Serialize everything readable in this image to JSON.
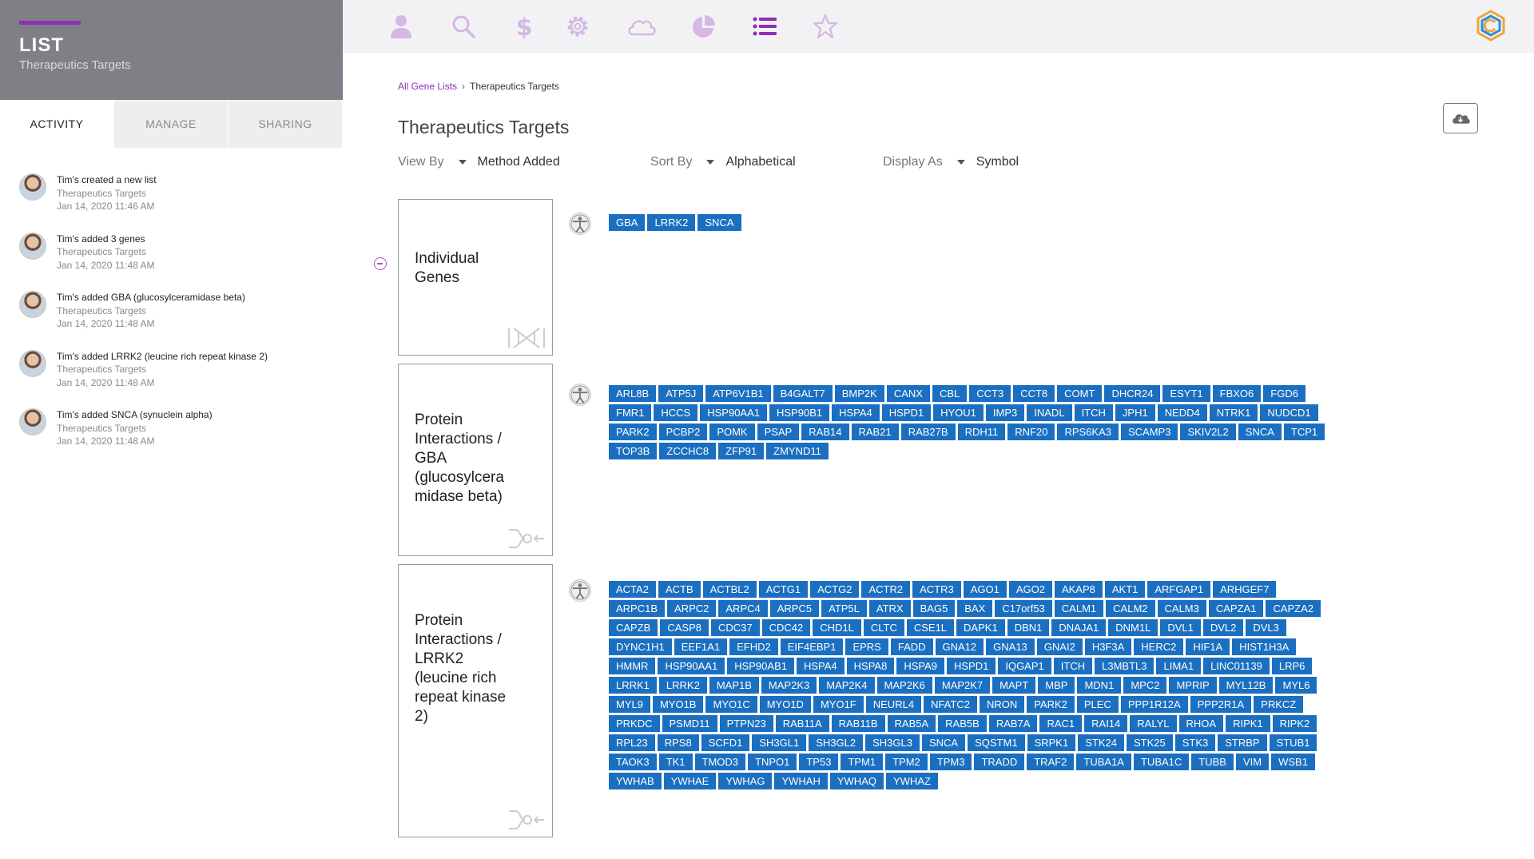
{
  "sidebar": {
    "title": "LIST",
    "subtitle": "Therapeutics Targets",
    "tabs": [
      "ACTIVITY",
      "MANAGE",
      "SHARING"
    ],
    "activity": [
      {
        "title": "Tim's created a new list",
        "list": "Therapeutics Targets",
        "time": "Jan 14, 2020 11:46 AM"
      },
      {
        "title": "Tim's added 3 genes",
        "list": "Therapeutics Targets",
        "time": "Jan 14, 2020 11:48 AM"
      },
      {
        "title": "Tim's added GBA (glucosylceramidase beta)",
        "list": "Therapeutics Targets",
        "time": "Jan 14, 2020 11:48 AM"
      },
      {
        "title": "Tim's added LRRK2 (leucine rich repeat kinase 2)",
        "list": "Therapeutics Targets",
        "time": "Jan 14, 2020 11:48 AM"
      },
      {
        "title": "Tim's added SNCA (synuclein alpha)",
        "list": "Therapeutics Targets",
        "time": "Jan 14, 2020 11:48 AM"
      }
    ]
  },
  "topbar": {
    "icons": [
      "user-icon",
      "search-icon",
      "dollar-icon",
      "gear-icon",
      "cloud-icon",
      "pie-chart-icon",
      "list-icon",
      "star-icon"
    ],
    "active_icon": "list-icon",
    "accent": "#8e2fb5",
    "icon_color": "#d5b8e3"
  },
  "breadcrumb": {
    "link": "All Gene Lists",
    "sep": "›",
    "current": "Therapeutics Targets"
  },
  "page_title": "Therapeutics Targets",
  "controls": {
    "view_by_label": "View By",
    "view_by_value": "Method Added",
    "sort_by_label": "Sort By",
    "sort_by_value": "Alphabetical",
    "display_as_label": "Display As",
    "display_as_value": "Symbol"
  },
  "chip_color": "#1b6fc0",
  "groups": [
    {
      "title_lines": [
        "Individual",
        "Genes"
      ],
      "icon": "dna-icon",
      "genes": [
        "GBA",
        "LRRK2",
        "SNCA"
      ]
    },
    {
      "title_lines": [
        "Protein",
        "Interactions /",
        "GBA",
        "(glucosylcera",
        "midase beta)"
      ],
      "icon": "interaction-icon",
      "genes": [
        "ARL8B",
        "ATP5J",
        "ATP6V1B1",
        "B4GALT7",
        "BMP2K",
        "CANX",
        "CBL",
        "CCT3",
        "CCT8",
        "COMT",
        "DHCR24",
        "ESYT1",
        "FBXO6",
        "FGD6",
        "FMR1",
        "HCCS",
        "HSP90AA1",
        "HSP90B1",
        "HSPA4",
        "HSPD1",
        "HYOU1",
        "IMP3",
        "INADL",
        "ITCH",
        "JPH1",
        "NEDD4",
        "NTRK1",
        "NUDCD1",
        "PARK2",
        "PCBP2",
        "POMK",
        "PSAP",
        "RAB14",
        "RAB21",
        "RAB27B",
        "RDH11",
        "RNF20",
        "RPS6KA3",
        "SCAMP3",
        "SKIV2L2",
        "SNCA",
        "TCP1",
        "TOP3B",
        "ZCCHC8",
        "ZFP91",
        "ZMYND11"
      ]
    },
    {
      "title_lines": [
        "Protein",
        "Interactions /",
        "LRRK2",
        "(leucine rich",
        "repeat kinase",
        "2)"
      ],
      "icon": "interaction-icon",
      "genes": [
        "ACTA2",
        "ACTB",
        "ACTBL2",
        "ACTG1",
        "ACTG2",
        "ACTR2",
        "ACTR3",
        "AGO1",
        "AGO2",
        "AKAP8",
        "AKT1",
        "ARFGAP1",
        "ARHGEF7",
        "ARPC1B",
        "ARPC2",
        "ARPC4",
        "ARPC5",
        "ATP5L",
        "ATRX",
        "BAG5",
        "BAX",
        "C17orf53",
        "CALM1",
        "CALM2",
        "CALM3",
        "CAPZA1",
        "CAPZA2",
        "CAPZB",
        "CASP8",
        "CDC37",
        "CDC42",
        "CHD1L",
        "CLTC",
        "CSE1L",
        "DAPK1",
        "DBN1",
        "DNAJA1",
        "DNM1L",
        "DVL1",
        "DVL2",
        "DVL3",
        "DYNC1H1",
        "EEF1A1",
        "EFHD2",
        "EIF4EBP1",
        "EPRS",
        "FADD",
        "GNA12",
        "GNA13",
        "GNAI2",
        "H3F3A",
        "HERC2",
        "HIF1A",
        "HIST1H3A",
        "HMMR",
        "HSP90AA1",
        "HSP90AB1",
        "HSPA4",
        "HSPA8",
        "HSPA9",
        "HSPD1",
        "IQGAP1",
        "ITCH",
        "L3MBTL3",
        "LIMA1",
        "LINC01139",
        "LRP6",
        "LRRK1",
        "LRRK2",
        "MAP1B",
        "MAP2K3",
        "MAP2K4",
        "MAP2K6",
        "MAP2K7",
        "MAPT",
        "MBP",
        "MDN1",
        "MPC2",
        "MPRIP",
        "MYL12B",
        "MYL6",
        "MYL9",
        "MYO1B",
        "MYO1C",
        "MYO1D",
        "MYO1F",
        "NEURL4",
        "NFATC2",
        "NRON",
        "PARK2",
        "PLEC",
        "PPP1R12A",
        "PPP2R1A",
        "PRKCZ",
        "PRKDC",
        "PSMD11",
        "PTPN23",
        "RAB11A",
        "RAB11B",
        "RAB5A",
        "RAB5B",
        "RAB7A",
        "RAC1",
        "RAI14",
        "RALYL",
        "RHOA",
        "RIPK1",
        "RIPK2",
        "RPL23",
        "RPS8",
        "SCFD1",
        "SH3GL1",
        "SH3GL2",
        "SH3GL3",
        "SNCA",
        "SQSTM1",
        "SRPK1",
        "STK24",
        "STK25",
        "STK3",
        "STRBP",
        "STUB1",
        "TAOK3",
        "TK1",
        "TMOD3",
        "TNPO1",
        "TP53",
        "TPM1",
        "TPM2",
        "TPM3",
        "TRADD",
        "TRAF2",
        "TUBA1A",
        "TUBA1C",
        "TUBB",
        "VIM",
        "WSB1",
        "YWHAB",
        "YWHAE",
        "YWHAG",
        "YWHAH",
        "YWHAQ",
        "YWHAZ"
      ]
    }
  ]
}
